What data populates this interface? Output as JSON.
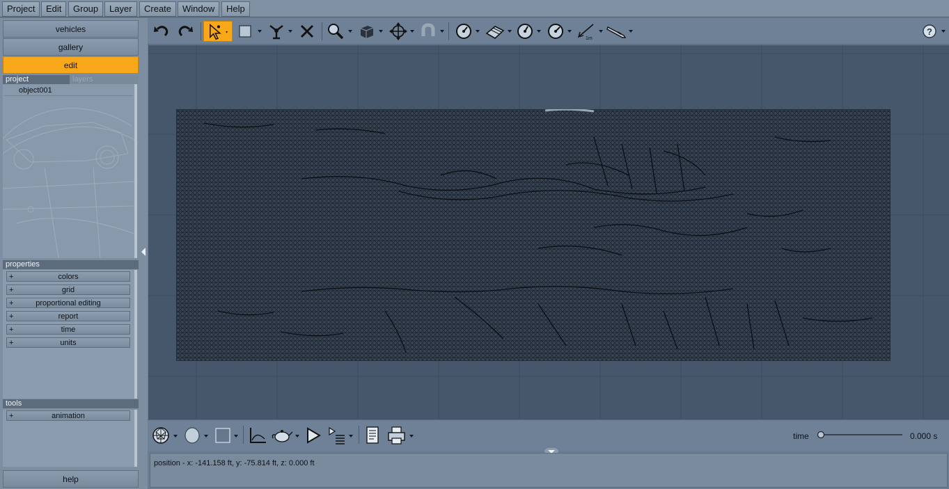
{
  "menu": [
    "Project",
    "Edit",
    "Group",
    "Layer",
    "Create",
    "Window",
    "Help"
  ],
  "nav": {
    "vehicles": "vehicles",
    "gallery": "gallery",
    "edit": "edit",
    "help": "help"
  },
  "tabs": {
    "project": "project",
    "layers": "layers"
  },
  "project_tree": {
    "items": [
      "object001"
    ]
  },
  "properties": {
    "header": "properties",
    "items": [
      "colors",
      "grid",
      "proportional editing",
      "report",
      "time",
      "units"
    ]
  },
  "tools": {
    "header": "tools",
    "items": [
      "animation"
    ]
  },
  "plus_sign": "+",
  "timeline": {
    "label": "time",
    "value": "0.000 s",
    "position": 0.0
  },
  "status": {
    "text": "position - x: -141.158 ft, y: -75.814 ft, z: 0.000 ft"
  },
  "toolbar_icons": [
    "undo-icon",
    "redo-icon",
    "select-arrow-icon",
    "rectangle-select-icon",
    "deform-tool-icon",
    "delete-icon",
    "zoom-icon",
    "cube-view-icon",
    "move-gizmo-icon",
    "magnet-icon",
    "measure-dial-icon",
    "surface-icon",
    "dial-icon",
    "dial-icon",
    "ruler-icon",
    "knife-icon",
    "help-icon"
  ],
  "ruler_label": "1m",
  "colors": {
    "accent": "#f9a81a",
    "viewport": "#46576b",
    "panel": "#7d8ea0"
  }
}
